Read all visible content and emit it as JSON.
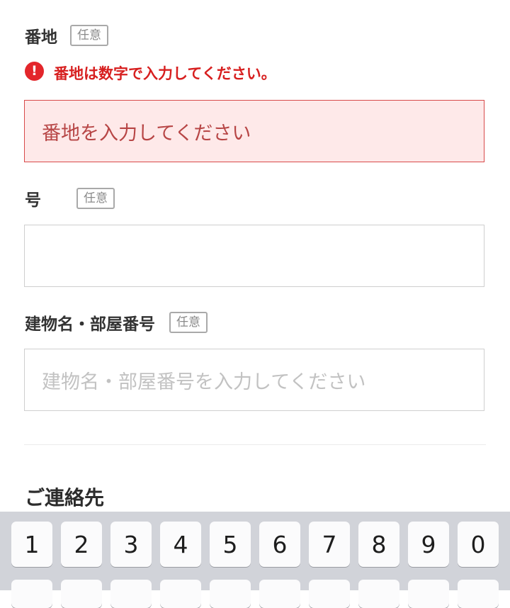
{
  "fields": {
    "banchi": {
      "label": "番地",
      "badge": "任意",
      "error": "番地は数字で入力してください。",
      "error_icon": "!",
      "placeholder": "番地を入力してください"
    },
    "go": {
      "label": "号",
      "badge": "任意",
      "value": ""
    },
    "building": {
      "label": "建物名・部屋番号",
      "badge": "任意",
      "placeholder": "建物名・部屋番号を入力してください"
    }
  },
  "section": {
    "title": "ご連絡先"
  },
  "keyboard": {
    "row1": [
      "1",
      "2",
      "3",
      "4",
      "5",
      "6",
      "7",
      "8",
      "9",
      "0"
    ]
  },
  "colors": {
    "error": "#d71f1f",
    "error_bg": "#fee9e9",
    "keyboard_bg": "#d1d3d9"
  }
}
